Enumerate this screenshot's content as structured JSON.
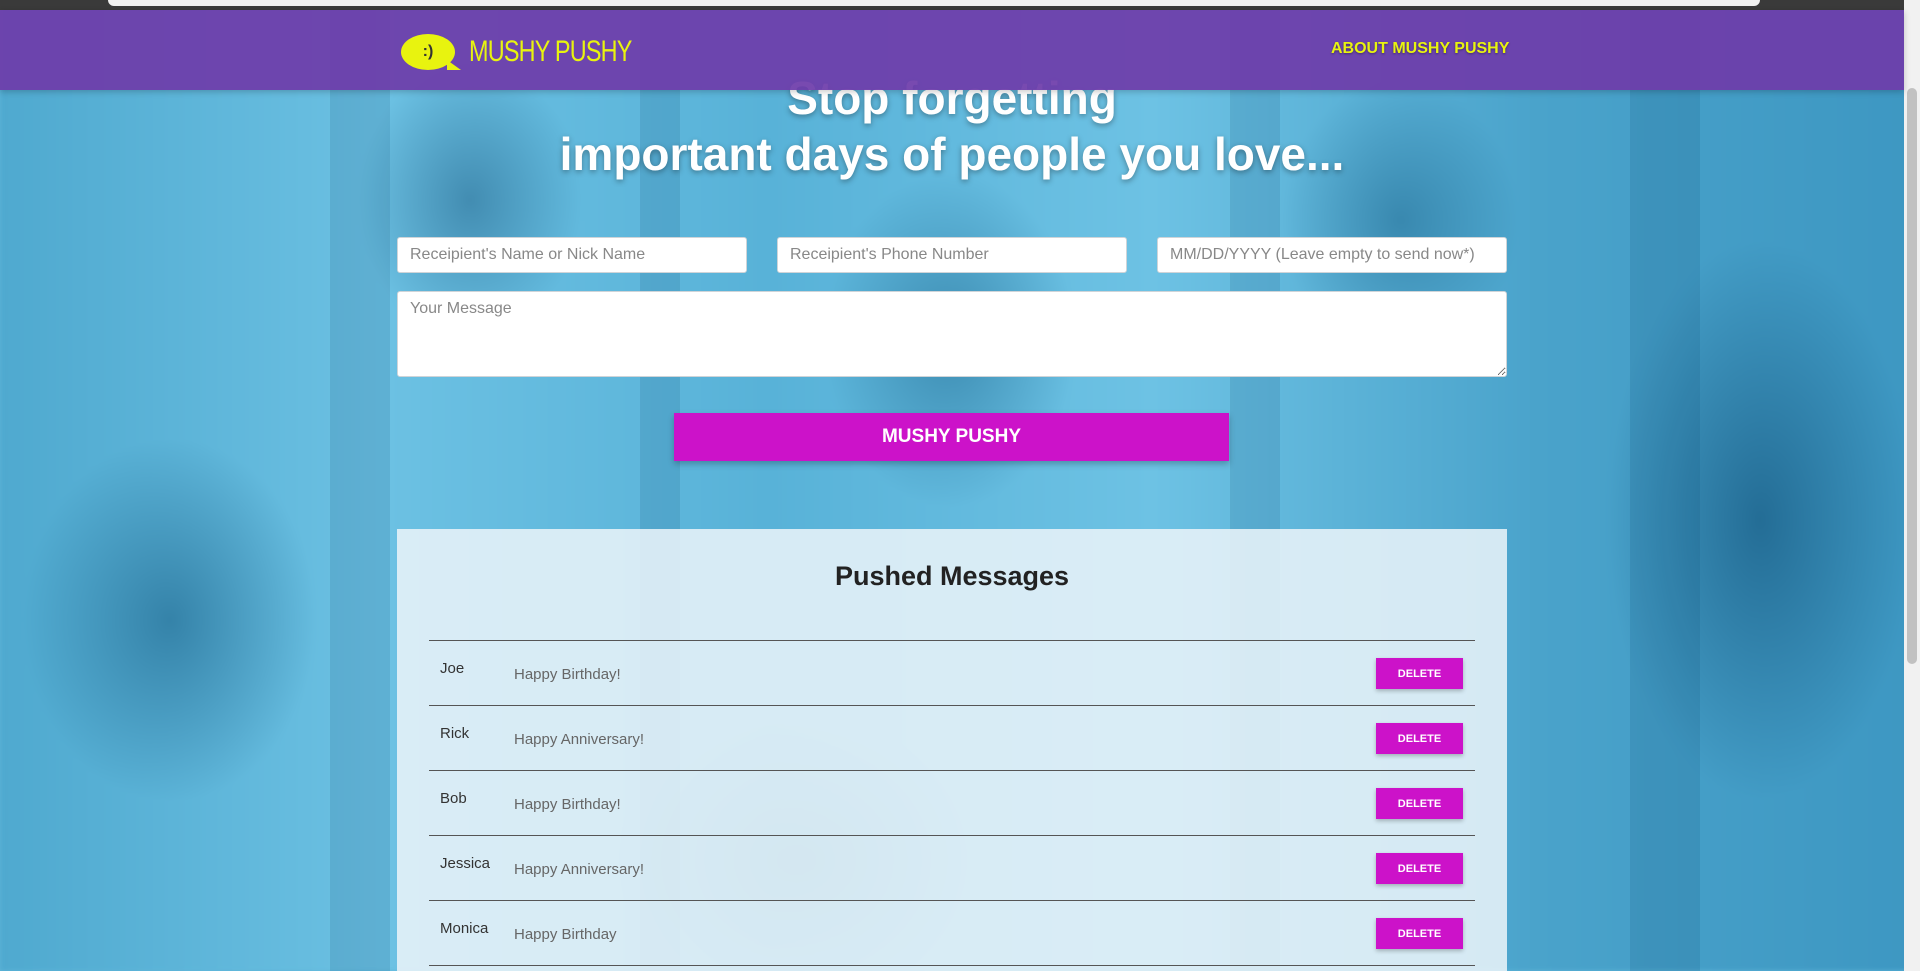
{
  "header": {
    "logo_face": ":)",
    "logo_text": "MUSHY PUSHY",
    "about_label": "ABOUT MUSHY PUSHY"
  },
  "hero": {
    "line1": "Stop forgetting",
    "line2": "important days of people you love..."
  },
  "form": {
    "name_placeholder": "Receipient's Name or Nick Name",
    "phone_placeholder": "Receipient's Phone Number",
    "date_placeholder": "MM/DD/YYYY (Leave empty to send now*)",
    "message_placeholder": "Your Message",
    "submit_label": "MUSHY PUSHY"
  },
  "messages": {
    "title": "Pushed Messages",
    "delete_label": "DELETE",
    "rows": [
      {
        "name": "Joe",
        "message": "Happy Birthday!"
      },
      {
        "name": "Rick",
        "message": "Happy Anniversary!"
      },
      {
        "name": "Bob",
        "message": "Happy Birthday!"
      },
      {
        "name": "Jessica",
        "message": "Happy Anniversary!"
      },
      {
        "name": "Monica",
        "message": "Happy Birthday"
      }
    ]
  },
  "colors": {
    "header_bg": "#6e3caa",
    "accent_yellow": "#e8f30f",
    "button_magenta": "#cc12c9"
  }
}
